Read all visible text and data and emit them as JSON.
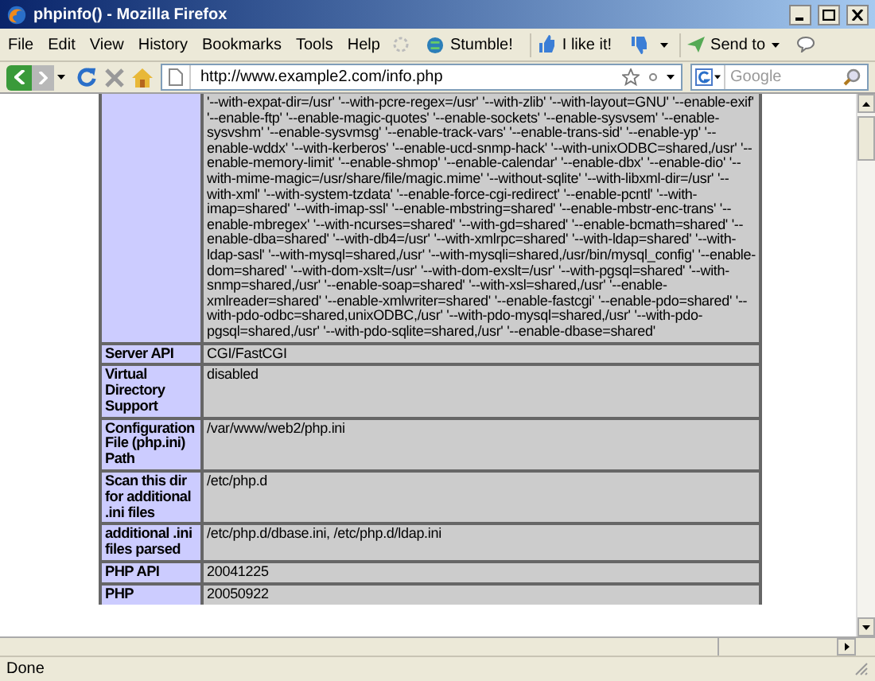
{
  "window": {
    "title": "phpinfo() - Mozilla Firefox"
  },
  "menu": [
    "File",
    "Edit",
    "View",
    "History",
    "Bookmarks",
    "Tools",
    "Help"
  ],
  "toolbar": {
    "stumble": "Stumble!",
    "like": "I like it!",
    "send": "Send to"
  },
  "address": {
    "url": "http://www.example2.com/info.php"
  },
  "search": {
    "placeholder": "Google"
  },
  "table": {
    "rows": [
      {
        "value": "'--with-expat-dir=/usr' '--with-pcre-regex=/usr' '--with-zlib' '--with-layout=GNU' '--enable-exif' '--enable-ftp' '--enable-magic-quotes' '--enable-sockets' '--enable-sysvsem' '--enable-sysvshm' '--enable-sysvmsg' '--enable-track-vars' '--enable-trans-sid' '--enable-yp' '--enable-wddx' '--with-kerberos' '--enable-ucd-snmp-hack' '--with-unixODBC=shared,/usr' '--enable-memory-limit' '--enable-shmop' '--enable-calendar' '--enable-dbx' '--enable-dio' '--with-mime-magic=/usr/share/file/magic.mime' '--without-sqlite' '--with-libxml-dir=/usr' '--with-xml' '--with-system-tzdata' '--enable-force-cgi-redirect' '--enable-pcntl' '--with-imap=shared' '--with-imap-ssl' '--enable-mbstring=shared' '--enable-mbstr-enc-trans' '--enable-mbregex' '--with-ncurses=shared' '--with-gd=shared' '--enable-bcmath=shared' '--enable-dba=shared' '--with-db4=/usr' '--with-xmlrpc=shared' '--with-ldap=shared' '--with-ldap-sasl' '--with-mysql=shared,/usr' '--with-mysqli=shared,/usr/bin/mysql_config' '--enable-dom=shared' '--with-dom-xslt=/usr' '--with-dom-exslt=/usr' '--with-pgsql=shared' '--with-snmp=shared,/usr' '--enable-soap=shared' '--with-xsl=shared,/usr' '--enable-xmlreader=shared' '--enable-xmlwriter=shared' '--enable-fastcgi' '--enable-pdo=shared' '--with-pdo-odbc=shared,unixODBC,/usr' '--with-pdo-mysql=shared,/usr' '--with-pdo-pgsql=shared,/usr' '--with-pdo-sqlite=shared,/usr' '--enable-dbase=shared'"
      },
      {
        "label": "Server API",
        "value": "CGI/FastCGI"
      },
      {
        "label": "Virtual Directory Support",
        "value": "disabled"
      },
      {
        "label": "Configuration File (php.ini) Path",
        "value": "/var/www/web2/php.ini"
      },
      {
        "label": "Scan this dir for additional .ini files",
        "value": "/etc/php.d"
      },
      {
        "label": "additional .ini files parsed",
        "value": "/etc/php.d/dbase.ini, /etc/php.d/ldap.ini"
      },
      {
        "label": "PHP API",
        "value": "20041225"
      },
      {
        "label": "PHP",
        "value": "20050922"
      }
    ]
  },
  "status_bar": {
    "text": "Done"
  }
}
